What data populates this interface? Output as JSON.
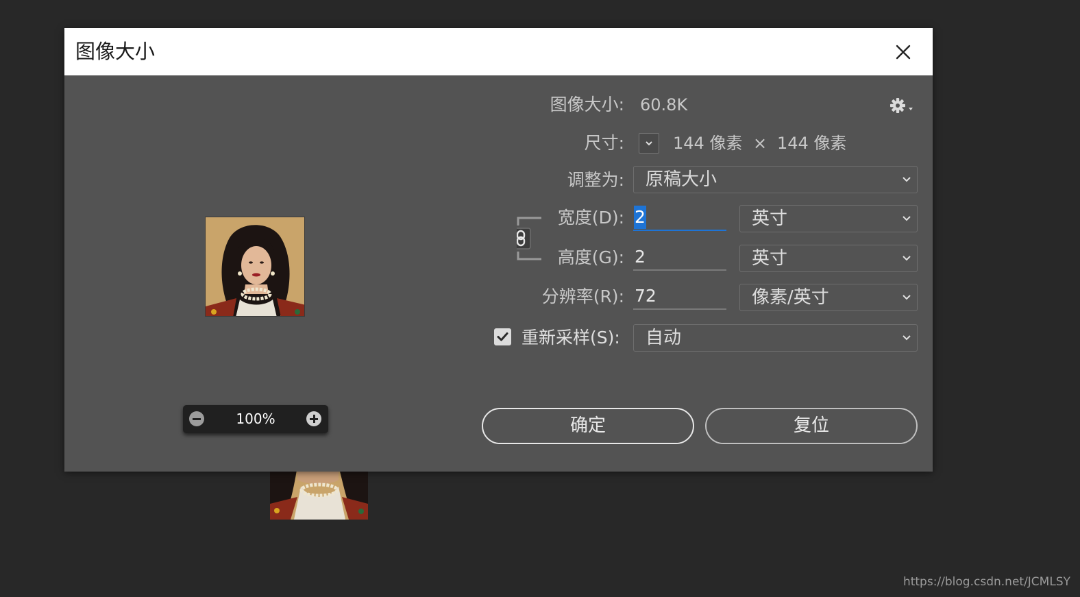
{
  "dialog": {
    "title": "图像大小",
    "close_icon": "close-icon"
  },
  "info": {
    "image_size_label": "图像大小:",
    "image_size_value": "60.8K",
    "dimensions_label": "尺寸:",
    "width_px": "144 像素",
    "times": "×",
    "height_px": "144 像素"
  },
  "fit_to": {
    "label": "调整为:",
    "value": "原稿大小"
  },
  "width": {
    "label": "宽度(D):",
    "value": "2",
    "unit": "英寸"
  },
  "height": {
    "label": "高度(G):",
    "value": "2",
    "unit": "英寸"
  },
  "resolution": {
    "label": "分辨率(R):",
    "value": "72",
    "unit": "像素/英寸"
  },
  "resample": {
    "checked": true,
    "label": "重新采样(S):",
    "value": "自动"
  },
  "zoom": {
    "value": "100%"
  },
  "buttons": {
    "ok": "确定",
    "reset": "复位"
  },
  "watermark": "https://blog.csdn.net/JCMLSY",
  "colors": {
    "dialog_bg": "#535353",
    "accent": "#1e74d6",
    "app_bg": "#282828"
  }
}
